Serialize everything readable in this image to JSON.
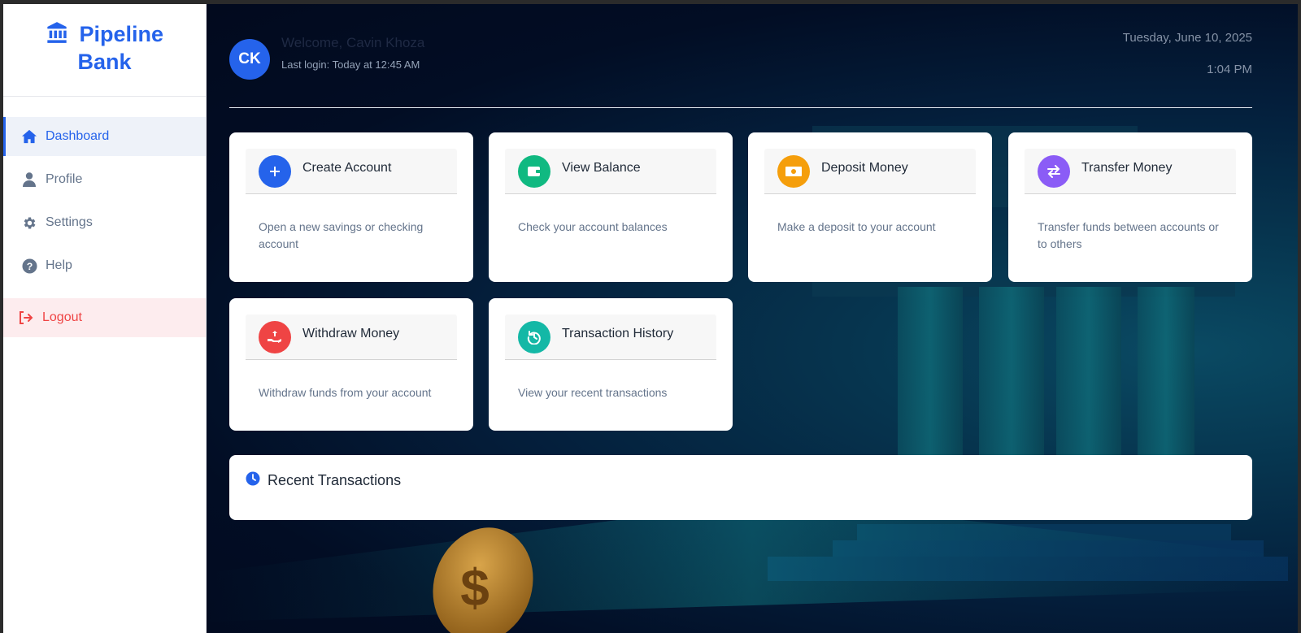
{
  "brand": {
    "name_line1": "Pipeline",
    "name_line2": "Bank"
  },
  "sidebar": {
    "items": [
      {
        "label": "Dashboard",
        "icon": "home-icon"
      },
      {
        "label": "Profile",
        "icon": "user-icon"
      },
      {
        "label": "Settings",
        "icon": "gear-icon"
      },
      {
        "label": "Help",
        "icon": "help-icon"
      }
    ],
    "logout": {
      "label": "Logout",
      "icon": "logout-icon"
    }
  },
  "header": {
    "avatar_initials": "CK",
    "welcome": "Welcome, Cavin Khoza",
    "last_login": "Last login: Today at 12:45 AM",
    "date": "Tuesday, June 10, 2025",
    "time": "1:04 PM"
  },
  "cards": [
    {
      "title": "Create Account",
      "desc": "Open a new savings or checking account",
      "icon": "plus-icon",
      "color": "#2563eb"
    },
    {
      "title": "View Balance",
      "desc": "Check your account balances",
      "icon": "wallet-icon",
      "color": "#10b981"
    },
    {
      "title": "Deposit Money",
      "desc": "Make a deposit to your account",
      "icon": "money-icon",
      "color": "#f59e0b"
    },
    {
      "title": "Transfer Money",
      "desc": "Transfer funds between accounts or to others",
      "icon": "transfer-icon",
      "color": "#8b5cf6"
    },
    {
      "title": "Withdraw Money",
      "desc": "Withdraw funds from your account",
      "icon": "withdraw-icon",
      "color": "#ef4444"
    },
    {
      "title": "Transaction History",
      "desc": "View your recent transactions",
      "icon": "history-icon",
      "color": "#14b8a6"
    }
  ],
  "recent": {
    "title": "Recent Transactions",
    "icon": "clock-icon"
  },
  "colors": {
    "accent": "#2563eb",
    "danger": "#ef4444"
  }
}
